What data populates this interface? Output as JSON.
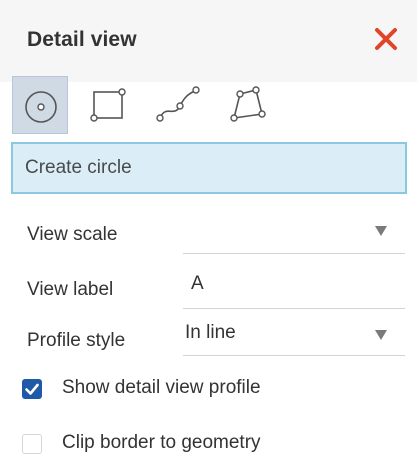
{
  "panel": {
    "title": "Detail view",
    "close_icon": "close-icon",
    "close_color": "#e0442a"
  },
  "tools": [
    {
      "name": "circle-tool",
      "icon": "circle-icon",
      "selected": true
    },
    {
      "name": "rectangle-tool",
      "icon": "rectangle-icon",
      "selected": false
    },
    {
      "name": "spline-tool",
      "icon": "spline-icon",
      "selected": false
    },
    {
      "name": "polygon-tool",
      "icon": "polygon-icon",
      "selected": false
    }
  ],
  "create_field": {
    "value": "Create circle"
  },
  "fields": {
    "view_scale": {
      "label": "View scale",
      "value": ""
    },
    "view_label": {
      "label": "View label",
      "value": "A"
    },
    "profile_style": {
      "label": "Profile style",
      "value": "In line"
    }
  },
  "checkboxes": {
    "show_profile": {
      "label": "Show detail view profile",
      "checked": true
    },
    "clip_border": {
      "label": "Clip border to geometry",
      "checked": false
    }
  },
  "colors": {
    "accent": "#1f5aa8",
    "selected_tool_bg": "#cfdae4",
    "create_field_bg": "#dbeef7",
    "create_field_border": "#8cc7e2"
  }
}
